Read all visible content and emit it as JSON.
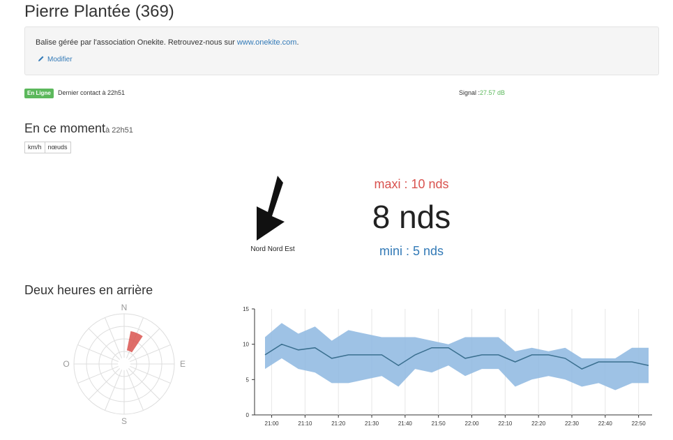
{
  "page": {
    "title": "Pierre Plantée (369)"
  },
  "info": {
    "text_before": "Balise gérée par l'association Onekite. Retrouvez-nous sur ",
    "link": "www.onekite.com",
    "text_after": ".",
    "edit_label": "Modifier"
  },
  "status": {
    "badge": "En Ligne",
    "last_contact": "Dernier contact à 22h51",
    "signal_label": "Signal :",
    "signal_value": "27.57 dB",
    "badge_color": "#5cb85c"
  },
  "now": {
    "heading": "En ce moment",
    "time": "à 22h51",
    "units": [
      "km/h",
      "nœuds"
    ],
    "direction": "Nord Nord Est",
    "maxi": "maxi : 10 nds",
    "current": "8 nds",
    "mini": "mini : 5 nds",
    "maxi_color": "#d9534f",
    "mini_color": "#337ab7"
  },
  "history": {
    "heading": "Deux heures en arrière",
    "rose": {
      "labels": {
        "n": "N",
        "e": "E",
        "s": "S",
        "w": "O"
      },
      "highlight_color": "#d9534f"
    }
  },
  "chart_data": {
    "type": "area",
    "ylim": [
      0,
      15
    ],
    "yticks": [
      0,
      5,
      10,
      15
    ],
    "xticks": [
      "21:00",
      "21:10",
      "21:20",
      "21:30",
      "21:40",
      "21:50",
      "22:00",
      "22:10",
      "22:20",
      "22:30",
      "22:40",
      "22:50"
    ],
    "x": [
      "20:58",
      "21:03",
      "21:08",
      "21:13",
      "21:18",
      "21:23",
      "21:28",
      "21:33",
      "21:38",
      "21:43",
      "21:48",
      "21:53",
      "21:58",
      "22:03",
      "22:08",
      "22:13",
      "22:18",
      "22:23",
      "22:28",
      "22:33",
      "22:38",
      "22:43",
      "22:48",
      "22:53"
    ],
    "series": [
      {
        "role": "max",
        "values": [
          11,
          13,
          11.5,
          12.5,
          10.5,
          12,
          11.5,
          11,
          11,
          11,
          10.5,
          10,
          11,
          11,
          11,
          9,
          9.5,
          9,
          9.5,
          8,
          8,
          8,
          9.5,
          9.5
        ]
      },
      {
        "role": "avg",
        "values": [
          8.5,
          10,
          9.2,
          9.5,
          8,
          8.5,
          8.5,
          8.5,
          7,
          8.5,
          9.5,
          9.5,
          8,
          8.5,
          8.5,
          7.5,
          8.5,
          8.5,
          8,
          6.5,
          7.5,
          7.5,
          7.5,
          7
        ]
      },
      {
        "role": "min",
        "values": [
          6.5,
          8,
          6.5,
          6,
          4.5,
          4.5,
          5,
          5.5,
          4,
          6.5,
          6,
          7,
          5.5,
          6.5,
          6.5,
          4,
          5,
          5.5,
          5,
          4,
          4.5,
          3.5,
          4.5,
          4.5
        ]
      }
    ],
    "colors": {
      "band": "#8db7e0",
      "line": "#3a6f8f"
    }
  }
}
